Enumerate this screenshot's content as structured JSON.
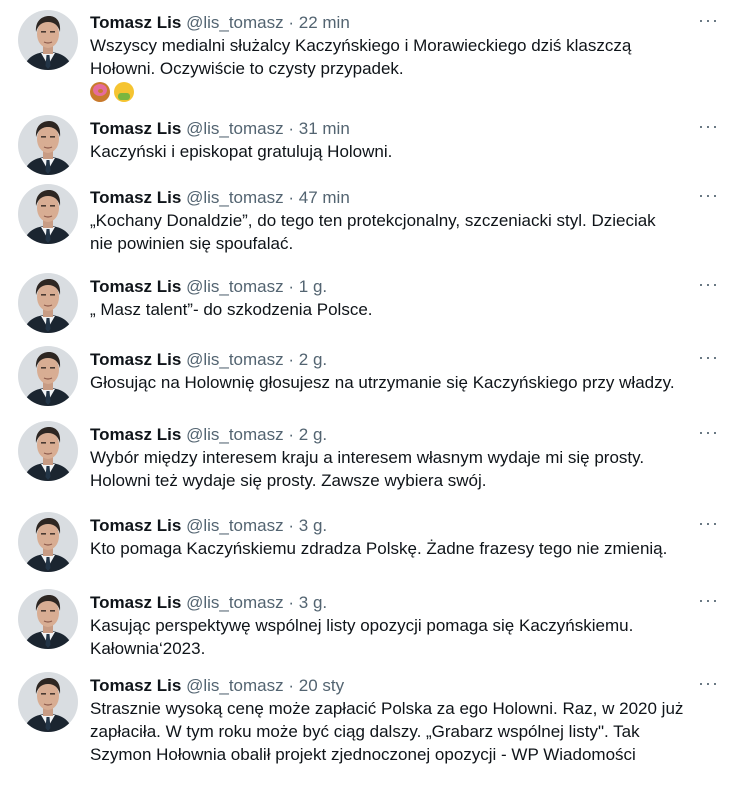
{
  "tweets": [
    {
      "name": "Tomasz Lis",
      "handle": "@lis_tomasz",
      "time": "22 min",
      "lines": [
        "Wszyscy medialni służalcy Kaczyńskiego i Morawieckiego dziś klaszczą",
        "Hołowni. Oczywiście to czysty przypadek."
      ],
      "emojis": [
        "doughnut-emoji",
        "nauseated-face-emoji"
      ]
    },
    {
      "name": "Tomasz Lis",
      "handle": "@lis_tomasz",
      "time": "31 min",
      "lines": [
        "Kaczyński i episkopat gratulują Holowni."
      ]
    },
    {
      "name": "Tomasz Lis",
      "handle": "@lis_tomasz",
      "time": "47 min",
      "lines": [
        "„Kochany Donaldzie”, do tego ten protekcjonalny, szczeniacki styl. Dzieciak",
        "nie powinien się spoufalać."
      ]
    },
    {
      "name": "Tomasz Lis",
      "handle": "@lis_tomasz",
      "time": "1 g.",
      "lines": [
        "„ Masz talent”- do szkodzenia Polsce."
      ]
    },
    {
      "name": "Tomasz Lis",
      "handle": "@lis_tomasz",
      "time": "2 g.",
      "lines": [
        "Głosując na Holownię głosujesz na utrzymanie się Kaczyńskiego przy władzy."
      ]
    },
    {
      "name": "Tomasz Lis",
      "handle": "@lis_tomasz",
      "time": "2 g.",
      "lines": [
        "Wybór między interesem kraju a interesem własnym wydaje mi się prosty.",
        "Holowni też wydaje się prosty. Zawsze wybiera swój."
      ]
    },
    {
      "name": "Tomasz Lis",
      "handle": "@lis_tomasz",
      "time": "3 g.",
      "lines": [
        "Kto pomaga Kaczyńskiemu zdradza Polskę. Żadne frazesy tego nie zmienią."
      ]
    },
    {
      "name": "Tomasz Lis",
      "handle": "@lis_tomasz",
      "time": "3 g.",
      "lines": [
        "Kasując perspektywę wspólnej listy opozycji pomaga się Kaczyńskiemu.",
        "Kałownia‘2023."
      ]
    },
    {
      "name": "Tomasz Lis",
      "handle": "@lis_tomasz",
      "time": "20 sty",
      "lines": [
        "Strasznie wysoką cenę może zapłacić Polska za ego Holowni. Raz, w 2020 już",
        "zapłaciła. W tym roku może być ciąg dalszy. „Grabarz wspólnej listy\". Tak",
        "Szymon Hołownia obalił projekt zjednoczonej opozycji - WP Wiadomości"
      ]
    }
  ],
  "separator": "·",
  "more_glyph": "···"
}
